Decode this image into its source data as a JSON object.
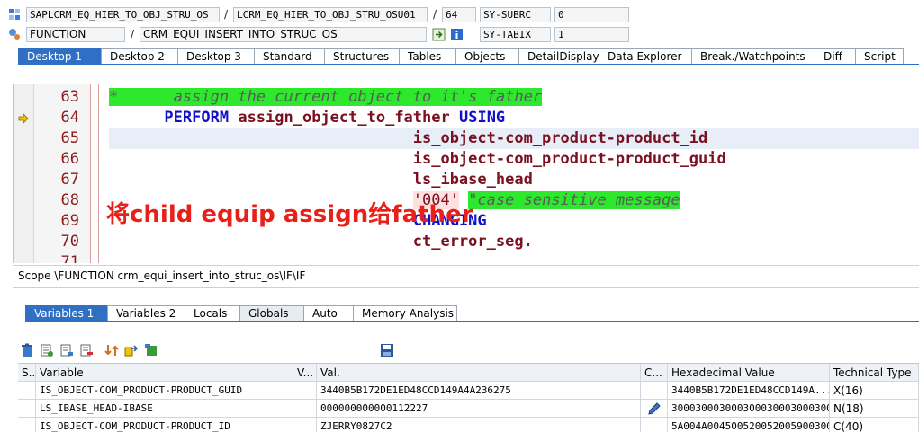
{
  "header": {
    "program": "SAPLCRM_EQ_HIER_TO_OBJ_STRU_OS",
    "include": "LCRM_EQ_HIER_TO_OBJ_STRU_OSU01",
    "line_no": "64",
    "subrc_label": "SY-SUBRC",
    "subrc_value": "0",
    "event_type": "FUNCTION",
    "event_name": "CRM_EQUI_INSERT_INTO_STRUC_OS",
    "tabix_label": "SY-TABIX",
    "tabix_value": "1"
  },
  "desktop_tabs": [
    "Desktop 1",
    "Desktop 2",
    "Desktop 3",
    "Standard",
    "Structures",
    "Tables",
    "Objects",
    "DetailDisplay",
    "Data Explorer",
    "Break./Watchpoints",
    "Diff",
    "Script"
  ],
  "code_lines": [
    {
      "num": "63",
      "parts": [
        {
          "t": "*      assign the current object to it's father",
          "c": "cmt"
        }
      ]
    },
    {
      "num": "64",
      "parts": [
        {
          "t": "      ",
          "c": ""
        },
        {
          "t": "PERFORM",
          "c": "kw"
        },
        {
          "t": " ",
          "c": ""
        },
        {
          "t": "assign_object_to_father",
          "c": "var"
        },
        {
          "t": " ",
          "c": ""
        },
        {
          "t": "USING",
          "c": "kw"
        }
      ]
    },
    {
      "num": "65",
      "parts": [
        {
          "t": "                                 is_object-com_product-product_id",
          "c": "var"
        }
      ]
    },
    {
      "num": "66",
      "parts": [
        {
          "t": "                                 is_object-com_product-product_guid",
          "c": "var"
        }
      ]
    },
    {
      "num": "67",
      "parts": [
        {
          "t": "                                 ls_ibase_head",
          "c": "var"
        }
      ]
    },
    {
      "num": "68",
      "parts": [
        {
          "t": "                                 ",
          "c": ""
        },
        {
          "t": "'004'",
          "c": "str"
        },
        {
          "t": " ",
          "c": ""
        },
        {
          "t": "\"case sensitive message",
          "c": "cmt"
        }
      ]
    },
    {
      "num": "69",
      "parts": [
        {
          "t": "                                 ",
          "c": ""
        },
        {
          "t": "CHANGING",
          "c": "kw"
        }
      ]
    },
    {
      "num": "70",
      "parts": [
        {
          "t": "                                 ct_error_seg.",
          "c": "var"
        }
      ]
    },
    {
      "num": "71",
      "parts": []
    }
  ],
  "annotation": "将child equip assign给father",
  "scope": "Scope \\FUNCTION crm_equi_insert_into_struc_os\\IF\\IF",
  "variable_tabs": [
    "Variables 1",
    "Variables 2",
    "Locals",
    "Globals",
    "Auto",
    "Memory Analysis"
  ],
  "table": {
    "headers": [
      "S...",
      "Variable",
      "V...",
      "Val.",
      "C...",
      "Hexadecimal Value",
      "Technical Type"
    ],
    "rows": [
      [
        "",
        "IS_OBJECT-COM_PRODUCT-PRODUCT_GUID",
        "",
        "3440B5B172DE1ED48CCD149A4A236275",
        "",
        "3440B5B172DE1ED48CCD149A...",
        "X(16)"
      ],
      [
        "",
        "LS_IBASE_HEAD-IBASE",
        "",
        "000000000000112227",
        "",
        "3000300030003000300030003000...",
        "N(18)"
      ],
      [
        "",
        "IS_OBJECT-COM_PRODUCT-PRODUCT_ID",
        "",
        "ZJERRY0827C2",
        "",
        "5A004A0045005200520059003000...",
        "C(40)"
      ]
    ]
  },
  "colors": {
    "active_tab": "#2f6fc4",
    "comment_bg": "#2ee82e",
    "keyword": "#1010c8",
    "annotation": "#e8201a"
  }
}
